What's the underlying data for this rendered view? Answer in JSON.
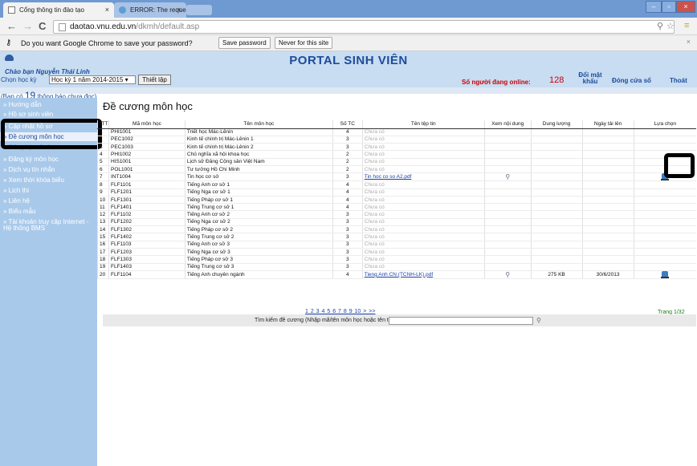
{
  "browser": {
    "tabs": [
      {
        "title": "Cổng thông tin đào tạo"
      },
      {
        "title": "ERROR: The requested URL"
      }
    ],
    "url_host": "daotao.vnu.edu.vn",
    "url_path": "/dkmh/default.asp"
  },
  "infobar": {
    "message": "Do you want Google Chrome to save your password?",
    "save_label": "Save password",
    "never_label": "Never for this site"
  },
  "header": {
    "title": "PORTAL SINH VIÊN",
    "greeting": "Chào bạn Nguyễn Thái Linh",
    "term_label": "Chọn học kỳ",
    "term_value": "Học kỳ 1 năm 2014-2015",
    "term_button": "Thiết lập",
    "online_label": "Số người đang online:",
    "online_count": "128",
    "change_password": "Đổi mật khẩu",
    "close_window": "Đóng cửa sổ",
    "logout": "Thoát"
  },
  "notice": {
    "prefix": "(Bạn có",
    "count": "19",
    "suffix": "thông báo chưa đọc)"
  },
  "sidebar": {
    "items": [
      "» Hướng dẫn",
      "» Hồ sơ sinh viên",
      "» Cập nhật hồ sơ",
      "» Đề cương môn học",
      "» Đăng ký môn học",
      "» Đăng ký môn học",
      "» Dịch vụ tín nhắn",
      "» Xem thời khóa biểu",
      "» Lịch thi",
      "» Liên hệ",
      "» Biểu mẫu",
      "» Tài khoản truy cập Internet - Hệ thống BMS"
    ],
    "selected_index": 3
  },
  "main": {
    "title": "Đề cương môn học",
    "columns": [
      "STT",
      "Mã môn học",
      "Tên môn học",
      "Số TC",
      "Tên tệp tin",
      "Xem nội dung",
      "Dung lượng",
      "Ngày tải lên",
      "Lựa chọn"
    ],
    "rows": [
      {
        "stt": "1",
        "code": "PHI1001",
        "name": "Triết học Mác-Lênin",
        "credits": "4",
        "file": "Chưa có"
      },
      {
        "stt": "2",
        "code": "PEC1002",
        "name": "Kinh tế chính trị Mác-Lênin 1",
        "credits": "3",
        "file": "Chưa có"
      },
      {
        "stt": "3",
        "code": "PEC1003",
        "name": "Kinh tế chính trị Mác-Lênin 2",
        "credits": "3",
        "file": "Chưa có"
      },
      {
        "stt": "4",
        "code": "PHI1002",
        "name": "Chủ nghĩa xã hội khoa học",
        "credits": "2",
        "file": "Chưa có"
      },
      {
        "stt": "5",
        "code": "HIS1001",
        "name": "Lịch sử Đảng Cộng sản Việt Nam",
        "credits": "2",
        "file": "Chưa có"
      },
      {
        "stt": "6",
        "code": "POL1001",
        "name": "Tư tưởng Hồ Chí Minh",
        "credits": "2",
        "file": "Chưa có"
      },
      {
        "stt": "7",
        "code": "INT1004",
        "name": "Tin học cơ sở",
        "credits": "3",
        "file": "Tin hoc co so A2.pdf",
        "link": true,
        "view": true,
        "download": true
      },
      {
        "stt": "8",
        "code": "FLF1101",
        "name": "Tiếng Anh cơ sở 1",
        "credits": "4",
        "file": "Chưa có"
      },
      {
        "stt": "9",
        "code": "FLF1201",
        "name": "Tiếng Nga cơ sở 1",
        "credits": "4",
        "file": "Chưa có"
      },
      {
        "stt": "10",
        "code": "FLF1301",
        "name": "Tiếng Pháp cơ sở 1",
        "credits": "4",
        "file": "Chưa có"
      },
      {
        "stt": "11",
        "code": "FLF1401",
        "name": "Tiếng Trung cơ sở 1",
        "credits": "4",
        "file": "Chưa có"
      },
      {
        "stt": "12",
        "code": "FLF1102",
        "name": "Tiếng Anh cơ sở 2",
        "credits": "3",
        "file": "Chưa có"
      },
      {
        "stt": "13",
        "code": "FLF1202",
        "name": "Tiếng Nga cơ sở 2",
        "credits": "3",
        "file": "Chưa có"
      },
      {
        "stt": "14",
        "code": "FLF1302",
        "name": "Tiếng Pháp cơ sở 2",
        "credits": "3",
        "file": "Chưa có"
      },
      {
        "stt": "15",
        "code": "FLF1402",
        "name": "Tiếng Trung cơ sở 2",
        "credits": "3",
        "file": "Chưa có"
      },
      {
        "stt": "16",
        "code": "FLF1103",
        "name": "Tiếng Anh cơ sở 3",
        "credits": "3",
        "file": "Chưa có"
      },
      {
        "stt": "17",
        "code": "FLF1203",
        "name": "Tiếng Nga cơ sở 3",
        "credits": "3",
        "file": "Chưa có"
      },
      {
        "stt": "18",
        "code": "FLF1303",
        "name": "Tiếng Pháp cơ sở 3",
        "credits": "3",
        "file": "Chưa có"
      },
      {
        "stt": "19",
        "code": "FLF1403",
        "name": "Tiếng Trung cơ sở 3",
        "credits": "3",
        "file": "Chưa có"
      },
      {
        "stt": "20",
        "code": "FLF1104",
        "name": "Tiếng Anh chuyên ngành",
        "credits": "4",
        "file": "Tieng Anh CN (TCNH-LK).pdf",
        "link": true,
        "view": true,
        "size": "275 KB",
        "date": "30/6/2013",
        "download": true
      }
    ],
    "pager": "1 2 3 4 5 6 7 8 9 10 > >>",
    "page_count": "Trang 1/32",
    "search_label": "Tìm kiếm đề cương (Nhập mã/tên môn học hoặc tên tệp tin)"
  },
  "colors": {
    "header_bg": "#c8ddf2",
    "sidebar_bg": "#a9c9ea",
    "portal_blue": "#1e4b9a",
    "online_red": "#cc0000"
  }
}
